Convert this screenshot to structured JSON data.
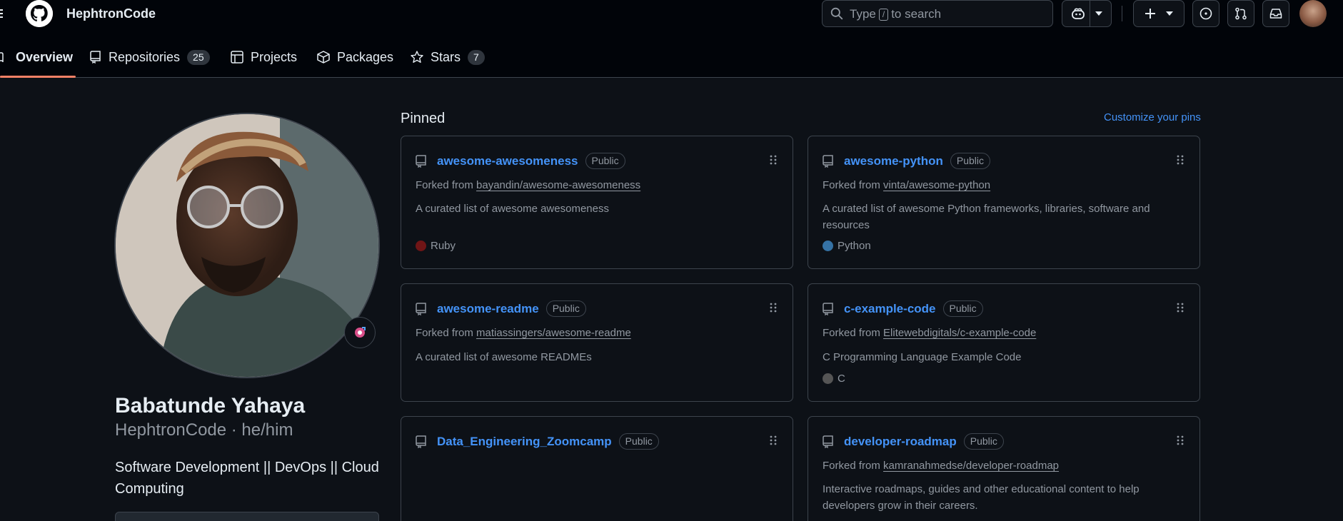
{
  "header": {
    "username": "HephtronCode",
    "search": {
      "prefix": "Type",
      "key": "/",
      "suffix": "to search"
    }
  },
  "nav": {
    "tabs": [
      {
        "label": "Overview",
        "icon": "book-icon",
        "active": true
      },
      {
        "label": "Repositories",
        "icon": "repo-icon",
        "count": "25"
      },
      {
        "label": "Projects",
        "icon": "table-icon"
      },
      {
        "label": "Packages",
        "icon": "package-icon"
      },
      {
        "label": "Stars",
        "icon": "star-icon",
        "count": "7"
      }
    ]
  },
  "profile": {
    "name": "Babatunde Yahaya",
    "handle": "HephtronCode · he/him",
    "bio": "Software Development || DevOps || Cloud Computing"
  },
  "pinned": {
    "title": "Pinned",
    "customize": "Customize your pins",
    "cards": [
      {
        "name": "awesome-awesomeness",
        "visibility": "Public",
        "fork_prefix": "Forked from",
        "fork_source": "bayandin/awesome-awesomeness",
        "description": "A curated list of awesome awesomeness",
        "language": "Ruby",
        "lang_color": "#701516"
      },
      {
        "name": "awesome-python",
        "visibility": "Public",
        "fork_prefix": "Forked from",
        "fork_source": "vinta/awesome-python",
        "description": "A curated list of awesome Python frameworks, libraries, software and resources",
        "language": "Python",
        "lang_color": "#3572A5"
      },
      {
        "name": "awesome-readme",
        "visibility": "Public",
        "fork_prefix": "Forked from",
        "fork_source": "matiassingers/awesome-readme",
        "description": "A curated list of awesome READMEs",
        "language": "",
        "lang_color": ""
      },
      {
        "name": "c-example-code",
        "visibility": "Public",
        "fork_prefix": "Forked from",
        "fork_source": "Elitewebdigitals/c-example-code",
        "description": "C Programming Language Example Code",
        "language": "C",
        "lang_color": "#555555"
      },
      {
        "name": "Data_Engineering_Zoomcamp",
        "visibility": "Public"
      },
      {
        "name": "developer-roadmap",
        "visibility": "Public",
        "fork_prefix": "Forked from",
        "fork_source": "kamranahmedse/developer-roadmap",
        "description": "Interactive roadmaps, guides and other educational content to help developers grow in their careers."
      }
    ]
  }
}
